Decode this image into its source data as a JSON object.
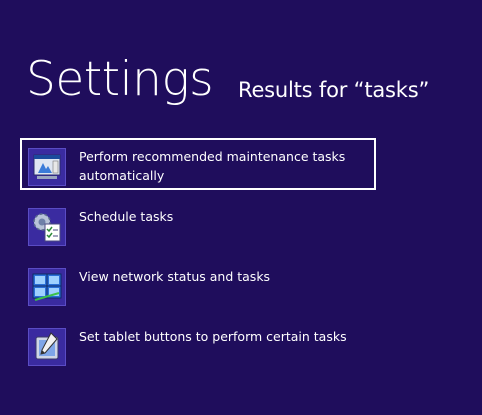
{
  "page": {
    "title": "Settings",
    "results_label": "Results for “tasks”"
  },
  "results": [
    {
      "label": "Perform recommended maintenance tasks automatically",
      "icon": "action-center-icon",
      "selected": true
    },
    {
      "label": "Schedule tasks",
      "icon": "task-scheduler-icon",
      "selected": false
    },
    {
      "label": "View network status and tasks",
      "icon": "network-center-icon",
      "selected": false
    },
    {
      "label": "Set tablet buttons to perform certain tasks",
      "icon": "tablet-settings-icon",
      "selected": false
    }
  ],
  "colors": {
    "background": "#1f0d5c",
    "icon_tile": "#3a2ba0",
    "selection_border": "#ffffff"
  }
}
